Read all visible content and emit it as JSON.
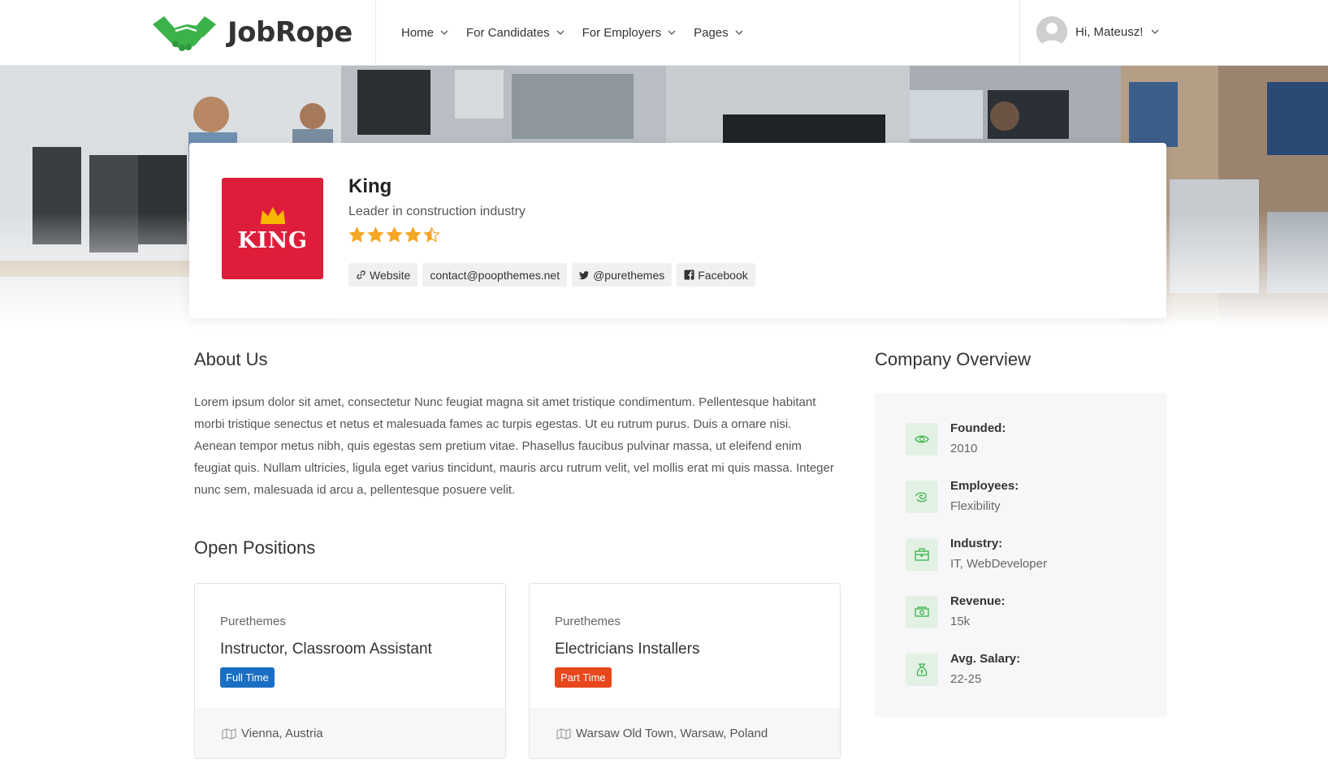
{
  "brand": {
    "name": "JobRope",
    "accent": "#3bb24a"
  },
  "nav": [
    {
      "label": "Home"
    },
    {
      "label": "For Candidates"
    },
    {
      "label": "For Employers"
    },
    {
      "label": "Pages"
    }
  ],
  "user": {
    "greeting": "Hi, Mateusz!"
  },
  "company": {
    "logo_text": "KING",
    "name": "King",
    "tagline": "Leader in construction industry",
    "rating": 4.5,
    "rating_max": 5,
    "links": {
      "website": "Website",
      "email": "contact@poopthemes.net",
      "twitter": "@purethemes",
      "facebook": "Facebook"
    }
  },
  "about": {
    "title": "About Us",
    "text": "Lorem ipsum dolor sit amet, consectetur Nunc feugiat magna sit amet tristique condimentum. Pellentesque habitant morbi tristique senectus et netus et malesuada fames ac turpis egestas. Ut eu rutrum purus. Duis a ornare nisi. Aenean tempor metus nibh, quis egestas sem pretium vitae. Phasellus faucibus pulvinar massa, ut eleifend enim feugiat quis. Nullam ultricies, ligula eget varius tincidunt, mauris arcu rutrum velit, vel mollis erat mi quis massa. Integer nunc sem, malesuada id arcu a, pellentesque posuere velit."
  },
  "positions": {
    "title": "Open Positions",
    "jobs": [
      {
        "company": "Purethemes",
        "title": "Instructor, Classroom Assistant",
        "type": "Full Time",
        "type_color": "#1a6fc4",
        "location": "Vienna, Austria"
      },
      {
        "company": "Purethemes",
        "title": "Electricians Installers",
        "type": "Part Time",
        "type_color": "#e8461b",
        "location": "Warsaw Old Town, Warsaw, Poland"
      }
    ]
  },
  "overview": {
    "title": "Company Overview",
    "items": [
      {
        "label": "Founded:",
        "value": "2010",
        "icon": "eye-icon"
      },
      {
        "label": "Employees:",
        "value": "Flexibility",
        "icon": "users-icon"
      },
      {
        "label": "Industry:",
        "value": "IT, WebDeveloper",
        "icon": "briefcase-icon"
      },
      {
        "label": "Revenue:",
        "value": "15k",
        "icon": "money-icon"
      },
      {
        "label": "Avg. Salary:",
        "value": "22-25",
        "icon": "money-bag-icon"
      }
    ]
  }
}
